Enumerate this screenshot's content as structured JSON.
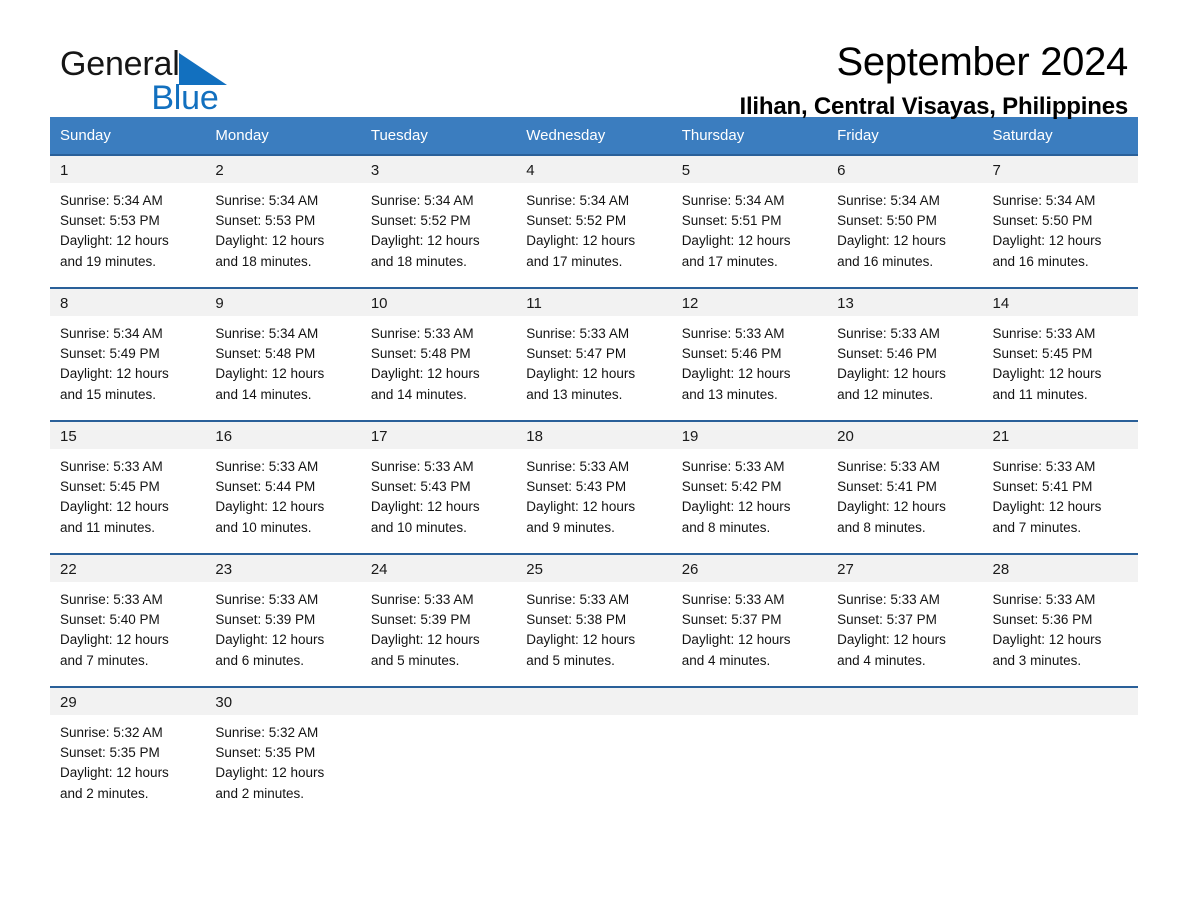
{
  "brand": {
    "name_part1": "General",
    "name_part2": "Blue",
    "logo_icon": "blue-triangle-logo"
  },
  "header": {
    "month_title": "September 2024",
    "location": "Ilihan, Central Visayas, Philippines"
  },
  "colors": {
    "header_blue": "#3b7dbf",
    "row_divider_blue": "#2a6099",
    "daynum_background": "#f2f2f2",
    "brand_blue": "#1270bf"
  },
  "calendar": {
    "weekday_headers": [
      "Sunday",
      "Monday",
      "Tuesday",
      "Wednesday",
      "Thursday",
      "Friday",
      "Saturday"
    ],
    "weeks": [
      [
        {
          "day": "1",
          "sunrise": "Sunrise: 5:34 AM",
          "sunset": "Sunset: 5:53 PM",
          "daylight_line1": "Daylight: 12 hours",
          "daylight_line2": "and 19 minutes."
        },
        {
          "day": "2",
          "sunrise": "Sunrise: 5:34 AM",
          "sunset": "Sunset: 5:53 PM",
          "daylight_line1": "Daylight: 12 hours",
          "daylight_line2": "and 18 minutes."
        },
        {
          "day": "3",
          "sunrise": "Sunrise: 5:34 AM",
          "sunset": "Sunset: 5:52 PM",
          "daylight_line1": "Daylight: 12 hours",
          "daylight_line2": "and 18 minutes."
        },
        {
          "day": "4",
          "sunrise": "Sunrise: 5:34 AM",
          "sunset": "Sunset: 5:52 PM",
          "daylight_line1": "Daylight: 12 hours",
          "daylight_line2": "and 17 minutes."
        },
        {
          "day": "5",
          "sunrise": "Sunrise: 5:34 AM",
          "sunset": "Sunset: 5:51 PM",
          "daylight_line1": "Daylight: 12 hours",
          "daylight_line2": "and 17 minutes."
        },
        {
          "day": "6",
          "sunrise": "Sunrise: 5:34 AM",
          "sunset": "Sunset: 5:50 PM",
          "daylight_line1": "Daylight: 12 hours",
          "daylight_line2": "and 16 minutes."
        },
        {
          "day": "7",
          "sunrise": "Sunrise: 5:34 AM",
          "sunset": "Sunset: 5:50 PM",
          "daylight_line1": "Daylight: 12 hours",
          "daylight_line2": "and 16 minutes."
        }
      ],
      [
        {
          "day": "8",
          "sunrise": "Sunrise: 5:34 AM",
          "sunset": "Sunset: 5:49 PM",
          "daylight_line1": "Daylight: 12 hours",
          "daylight_line2": "and 15 minutes."
        },
        {
          "day": "9",
          "sunrise": "Sunrise: 5:34 AM",
          "sunset": "Sunset: 5:48 PM",
          "daylight_line1": "Daylight: 12 hours",
          "daylight_line2": "and 14 minutes."
        },
        {
          "day": "10",
          "sunrise": "Sunrise: 5:33 AM",
          "sunset": "Sunset: 5:48 PM",
          "daylight_line1": "Daylight: 12 hours",
          "daylight_line2": "and 14 minutes."
        },
        {
          "day": "11",
          "sunrise": "Sunrise: 5:33 AM",
          "sunset": "Sunset: 5:47 PM",
          "daylight_line1": "Daylight: 12 hours",
          "daylight_line2": "and 13 minutes."
        },
        {
          "day": "12",
          "sunrise": "Sunrise: 5:33 AM",
          "sunset": "Sunset: 5:46 PM",
          "daylight_line1": "Daylight: 12 hours",
          "daylight_line2": "and 13 minutes."
        },
        {
          "day": "13",
          "sunrise": "Sunrise: 5:33 AM",
          "sunset": "Sunset: 5:46 PM",
          "daylight_line1": "Daylight: 12 hours",
          "daylight_line2": "and 12 minutes."
        },
        {
          "day": "14",
          "sunrise": "Sunrise: 5:33 AM",
          "sunset": "Sunset: 5:45 PM",
          "daylight_line1": "Daylight: 12 hours",
          "daylight_line2": "and 11 minutes."
        }
      ],
      [
        {
          "day": "15",
          "sunrise": "Sunrise: 5:33 AM",
          "sunset": "Sunset: 5:45 PM",
          "daylight_line1": "Daylight: 12 hours",
          "daylight_line2": "and 11 minutes."
        },
        {
          "day": "16",
          "sunrise": "Sunrise: 5:33 AM",
          "sunset": "Sunset: 5:44 PM",
          "daylight_line1": "Daylight: 12 hours",
          "daylight_line2": "and 10 minutes."
        },
        {
          "day": "17",
          "sunrise": "Sunrise: 5:33 AM",
          "sunset": "Sunset: 5:43 PM",
          "daylight_line1": "Daylight: 12 hours",
          "daylight_line2": "and 10 minutes."
        },
        {
          "day": "18",
          "sunrise": "Sunrise: 5:33 AM",
          "sunset": "Sunset: 5:43 PM",
          "daylight_line1": "Daylight: 12 hours",
          "daylight_line2": "and 9 minutes."
        },
        {
          "day": "19",
          "sunrise": "Sunrise: 5:33 AM",
          "sunset": "Sunset: 5:42 PM",
          "daylight_line1": "Daylight: 12 hours",
          "daylight_line2": "and 8 minutes."
        },
        {
          "day": "20",
          "sunrise": "Sunrise: 5:33 AM",
          "sunset": "Sunset: 5:41 PM",
          "daylight_line1": "Daylight: 12 hours",
          "daylight_line2": "and 8 minutes."
        },
        {
          "day": "21",
          "sunrise": "Sunrise: 5:33 AM",
          "sunset": "Sunset: 5:41 PM",
          "daylight_line1": "Daylight: 12 hours",
          "daylight_line2": "and 7 minutes."
        }
      ],
      [
        {
          "day": "22",
          "sunrise": "Sunrise: 5:33 AM",
          "sunset": "Sunset: 5:40 PM",
          "daylight_line1": "Daylight: 12 hours",
          "daylight_line2": "and 7 minutes."
        },
        {
          "day": "23",
          "sunrise": "Sunrise: 5:33 AM",
          "sunset": "Sunset: 5:39 PM",
          "daylight_line1": "Daylight: 12 hours",
          "daylight_line2": "and 6 minutes."
        },
        {
          "day": "24",
          "sunrise": "Sunrise: 5:33 AM",
          "sunset": "Sunset: 5:39 PM",
          "daylight_line1": "Daylight: 12 hours",
          "daylight_line2": "and 5 minutes."
        },
        {
          "day": "25",
          "sunrise": "Sunrise: 5:33 AM",
          "sunset": "Sunset: 5:38 PM",
          "daylight_line1": "Daylight: 12 hours",
          "daylight_line2": "and 5 minutes."
        },
        {
          "day": "26",
          "sunrise": "Sunrise: 5:33 AM",
          "sunset": "Sunset: 5:37 PM",
          "daylight_line1": "Daylight: 12 hours",
          "daylight_line2": "and 4 minutes."
        },
        {
          "day": "27",
          "sunrise": "Sunrise: 5:33 AM",
          "sunset": "Sunset: 5:37 PM",
          "daylight_line1": "Daylight: 12 hours",
          "daylight_line2": "and 4 minutes."
        },
        {
          "day": "28",
          "sunrise": "Sunrise: 5:33 AM",
          "sunset": "Sunset: 5:36 PM",
          "daylight_line1": "Daylight: 12 hours",
          "daylight_line2": "and 3 minutes."
        }
      ],
      [
        {
          "day": "29",
          "sunrise": "Sunrise: 5:32 AM",
          "sunset": "Sunset: 5:35 PM",
          "daylight_line1": "Daylight: 12 hours",
          "daylight_line2": "and 2 minutes."
        },
        {
          "day": "30",
          "sunrise": "Sunrise: 5:32 AM",
          "sunset": "Sunset: 5:35 PM",
          "daylight_line1": "Daylight: 12 hours",
          "daylight_line2": "and 2 minutes."
        },
        {
          "day": "",
          "sunrise": "",
          "sunset": "",
          "daylight_line1": "",
          "daylight_line2": ""
        },
        {
          "day": "",
          "sunrise": "",
          "sunset": "",
          "daylight_line1": "",
          "daylight_line2": ""
        },
        {
          "day": "",
          "sunrise": "",
          "sunset": "",
          "daylight_line1": "",
          "daylight_line2": ""
        },
        {
          "day": "",
          "sunrise": "",
          "sunset": "",
          "daylight_line1": "",
          "daylight_line2": ""
        },
        {
          "day": "",
          "sunrise": "",
          "sunset": "",
          "daylight_line1": "",
          "daylight_line2": ""
        }
      ]
    ]
  }
}
